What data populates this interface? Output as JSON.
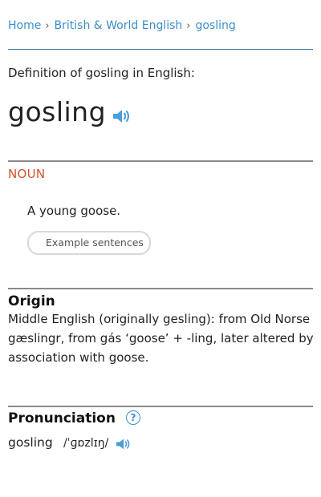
{
  "breadcrumb": {
    "items": [
      "Home",
      "British & World English",
      "gosling"
    ],
    "separator": "›"
  },
  "definition_heading": "Definition of gosling in English:",
  "headword": "gosling",
  "part_of_speech": "NOUN",
  "sense": "A young goose.",
  "example_button_label": "Example sentences",
  "origin": {
    "title": "Origin",
    "text": "Middle English (originally gesling): from Old Norse gæslingr, from gás ‘goose’ + -ling, later altered by association with goose."
  },
  "pronunciation": {
    "title": "Pronunciation",
    "help_symbol": "?",
    "word": "gosling",
    "ipa": "/ˈɡɒzlɪŋ/"
  },
  "colors": {
    "link": "#3a8ec9",
    "noun_label": "#d0542c",
    "rule_blue": "#2e6f92",
    "rule_grey": "#8a8a8a",
    "speaker": "#4a9fd8"
  },
  "icons": [
    "speaker-icon",
    "help-icon"
  ]
}
